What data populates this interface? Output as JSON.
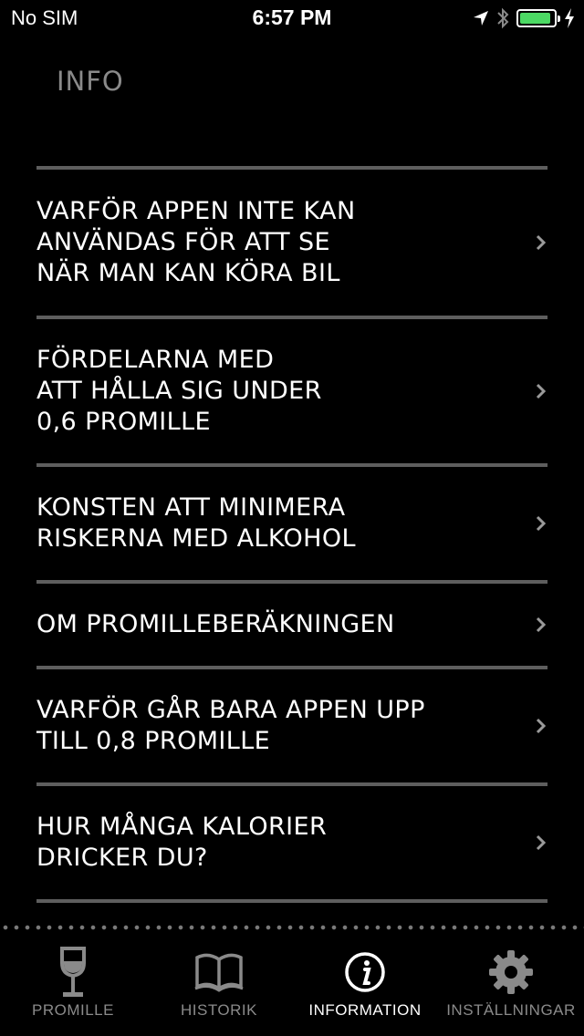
{
  "status_bar": {
    "carrier": "No SIM",
    "time": "6:57 PM",
    "battery_level": 0.92,
    "battery_color": "#4cd964"
  },
  "header": {
    "title": "INFO"
  },
  "menu": {
    "items": [
      {
        "label": "VARFÖR APPEN INTE KAN\nANVÄNDAS FÖR ATT SE\nNÄR MAN KAN KÖRA BIL"
      },
      {
        "label": "FÖRDELARNA MED\nATT HÅLLA SIG UNDER\n0,6 PROMILLE"
      },
      {
        "label": "KONSTEN ATT MINIMERA\nRISKERNA MED ALKOHOL"
      },
      {
        "label": "OM PROMILLEBERÄKNINGEN"
      },
      {
        "label": "VARFÖR GÅR BARA APPEN UPP\nTILL 0,8 PROMILLE"
      },
      {
        "label": "HUR MÅNGA KALORIER\nDRICKER DU?"
      }
    ]
  },
  "tab_bar": {
    "tabs": [
      {
        "label": "PROMILLE",
        "icon": "wine-glass-icon"
      },
      {
        "label": "HISTORIK",
        "icon": "book-icon"
      },
      {
        "label": "INFORMATION",
        "icon": "info-icon"
      },
      {
        "label": "INSTÄLLNINGAR",
        "icon": "gear-icon"
      }
    ],
    "active_tab": "INFORMATION",
    "active_color": "#ffffff",
    "inactive_color": "#8a8a8a"
  }
}
